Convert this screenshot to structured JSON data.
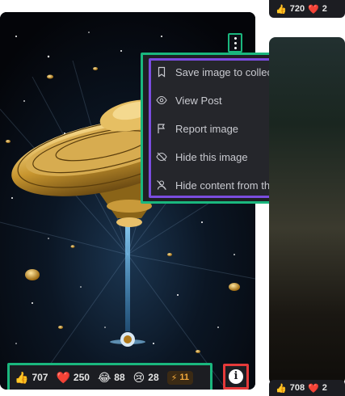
{
  "card": {
    "menu_items": [
      {
        "label": "Save image to collection",
        "icon": "bookmark-icon"
      },
      {
        "label": "View Post",
        "icon": "eye-icon"
      },
      {
        "label": "Report image",
        "icon": "flag-icon"
      },
      {
        "label": "Hide this image",
        "icon": "eye-off-icon"
      },
      {
        "label": "Hide content from this user",
        "icon": "user-off-icon"
      }
    ],
    "reactions": {
      "like": "707",
      "heart": "250",
      "laugh": "88",
      "cry": "28",
      "buzz": "11"
    },
    "info_icon": "info-icon"
  },
  "side_card_top": {
    "like": "720",
    "heart": "2"
  },
  "side_card_bottom": {
    "like": "708",
    "heart": "2"
  },
  "colors": {
    "outline_green": "#1ab77e",
    "outline_purple": "#7b4de0",
    "outline_red": "#e53a3a",
    "buzz": "#f2a93b"
  }
}
